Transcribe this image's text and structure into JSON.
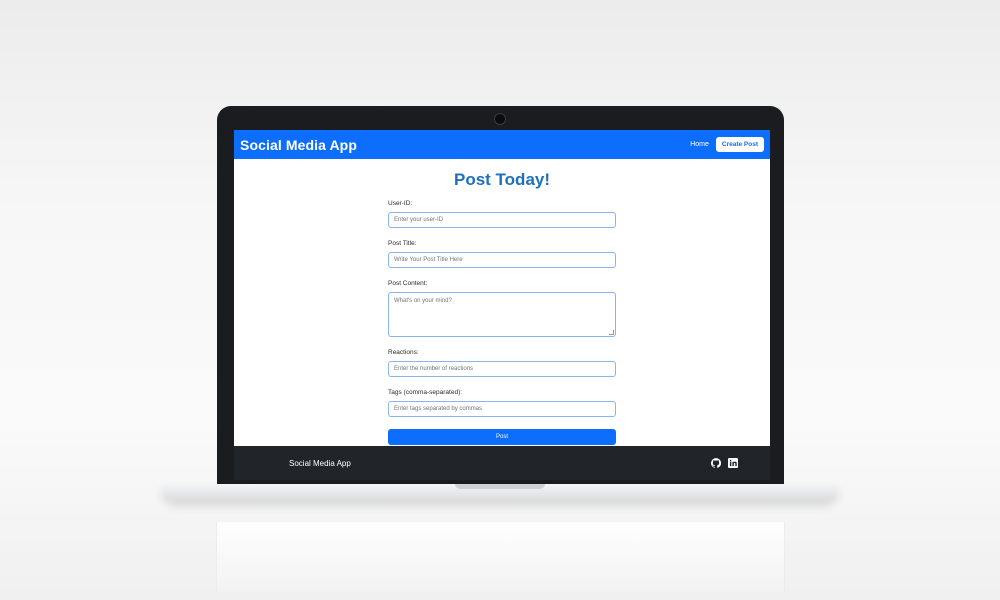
{
  "navbar": {
    "brand": "Social Media App",
    "home_link": "Home",
    "create_post_button": "Create Post"
  },
  "page": {
    "title": "Post Today!"
  },
  "form": {
    "user_id": {
      "label": "User-ID:",
      "placeholder": "Enter your user-ID"
    },
    "post_title": {
      "label": "Post Title:",
      "placeholder": "Write Your Post Title Here"
    },
    "post_content": {
      "label": "Post Content:",
      "placeholder": "What's on your mind?"
    },
    "reactions": {
      "label": "Reactions:",
      "placeholder": "Enter the number of reactions"
    },
    "tags": {
      "label": "Tags (comma-separated):",
      "placeholder": "Enter tags separated by commas"
    },
    "submit_label": "Post"
  },
  "footer": {
    "text": "Social Media App",
    "icons": [
      "github-icon",
      "linkedin-icon"
    ]
  },
  "colors": {
    "primary": "#0d6efd",
    "title": "#1f6fbf",
    "footer_bg": "#212529"
  }
}
